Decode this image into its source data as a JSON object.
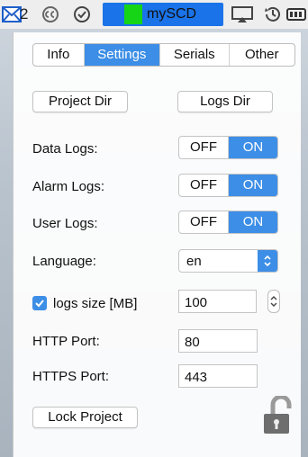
{
  "menubar": {
    "mail_count": "2",
    "app_name": "mySCD",
    "icons": [
      "mail-icon",
      "creative-commons-icon",
      "checkmark-circle-icon",
      "status-dot-icon",
      "airplay-icon",
      "history-icon",
      "battery-icon"
    ]
  },
  "tabs": [
    {
      "label": "Info",
      "active": false
    },
    {
      "label": "Settings",
      "active": true
    },
    {
      "label": "Serials",
      "active": false
    },
    {
      "label": "Other",
      "active": false
    }
  ],
  "buttons": {
    "project_dir": "Project Dir",
    "logs_dir": "Logs Dir",
    "lock_project": "Lock Project"
  },
  "settings": {
    "data_logs": {
      "label": "Data Logs:",
      "off": "OFF",
      "on": "ON",
      "value": "ON"
    },
    "alarm_logs": {
      "label": "Alarm Logs:",
      "off": "OFF",
      "on": "ON",
      "value": "ON"
    },
    "user_logs": {
      "label": "User Logs:",
      "off": "OFF",
      "on": "ON",
      "value": "ON"
    },
    "language": {
      "label": "Language:",
      "value": "en"
    },
    "logs_size": {
      "label": "logs size [MB]",
      "checked": true,
      "value": "100"
    },
    "http_port": {
      "label": "HTTP Port:",
      "value": "80"
    },
    "https_port": {
      "label": "HTTPS Port:",
      "value": "443"
    }
  },
  "colors": {
    "accent": "#3d8ee6",
    "status_green": "#16d416",
    "highlight": "#1a73e8"
  }
}
